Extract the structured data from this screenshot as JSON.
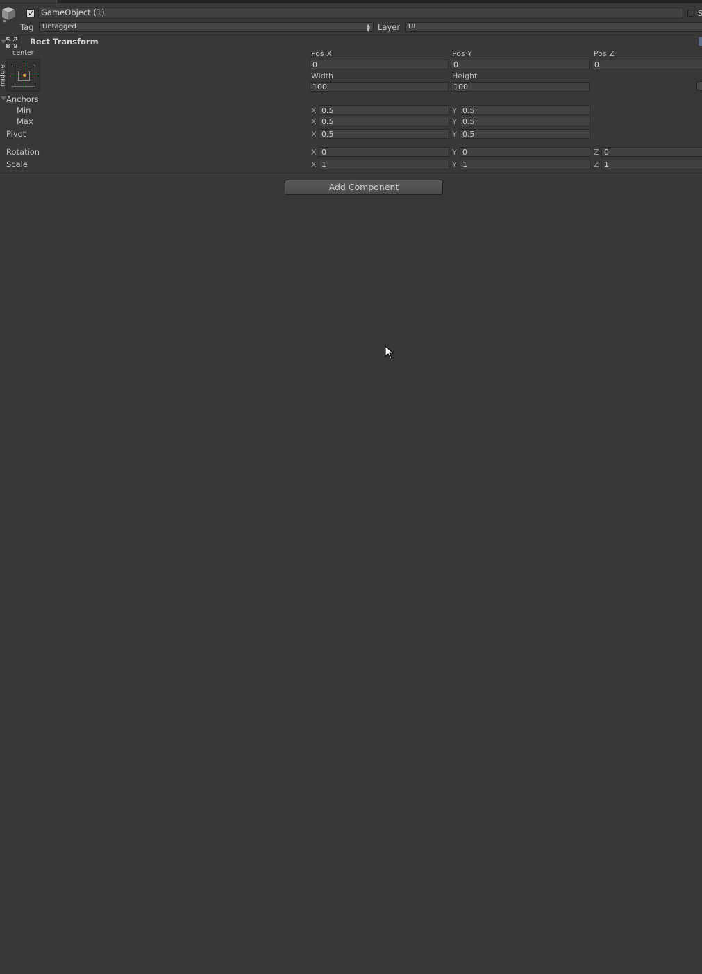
{
  "header": {
    "object_name": "GameObject (1)",
    "active": true,
    "static_label": "S",
    "tag_label": "Tag",
    "tag_value": "Untagged",
    "layer_label": "Layer",
    "layer_value": "UI"
  },
  "rect_transform": {
    "title": "Rect Transform",
    "preset_top_label": "center",
    "preset_side_label": "middle",
    "pos_x_label": "Pos X",
    "pos_y_label": "Pos Y",
    "pos_z_label": "Pos Z",
    "pos_x": "0",
    "pos_y": "0",
    "pos_z": "0",
    "width_label": "Width",
    "height_label": "Height",
    "width": "100",
    "height": "100",
    "anchors_label": "Anchors",
    "min_label": "Min",
    "max_label": "Max",
    "pivot_label": "Pivot",
    "rotation_label": "Rotation",
    "scale_label": "Scale",
    "axis_x": "X",
    "axis_y": "Y",
    "axis_z": "Z",
    "anchor_min_x": "0.5",
    "anchor_min_y": "0.5",
    "anchor_max_x": "0.5",
    "anchor_max_y": "0.5",
    "pivot_x": "0.5",
    "pivot_y": "0.5",
    "rotation_x": "0",
    "rotation_y": "0",
    "rotation_z": "0",
    "scale_x": "1",
    "scale_y": "1",
    "scale_z": "1"
  },
  "add_component_label": "Add Component",
  "colors": {
    "background": "#383838",
    "field": "#414141",
    "anchor_line": "#b44a3a",
    "anchor_dot": "#e2b24a"
  }
}
